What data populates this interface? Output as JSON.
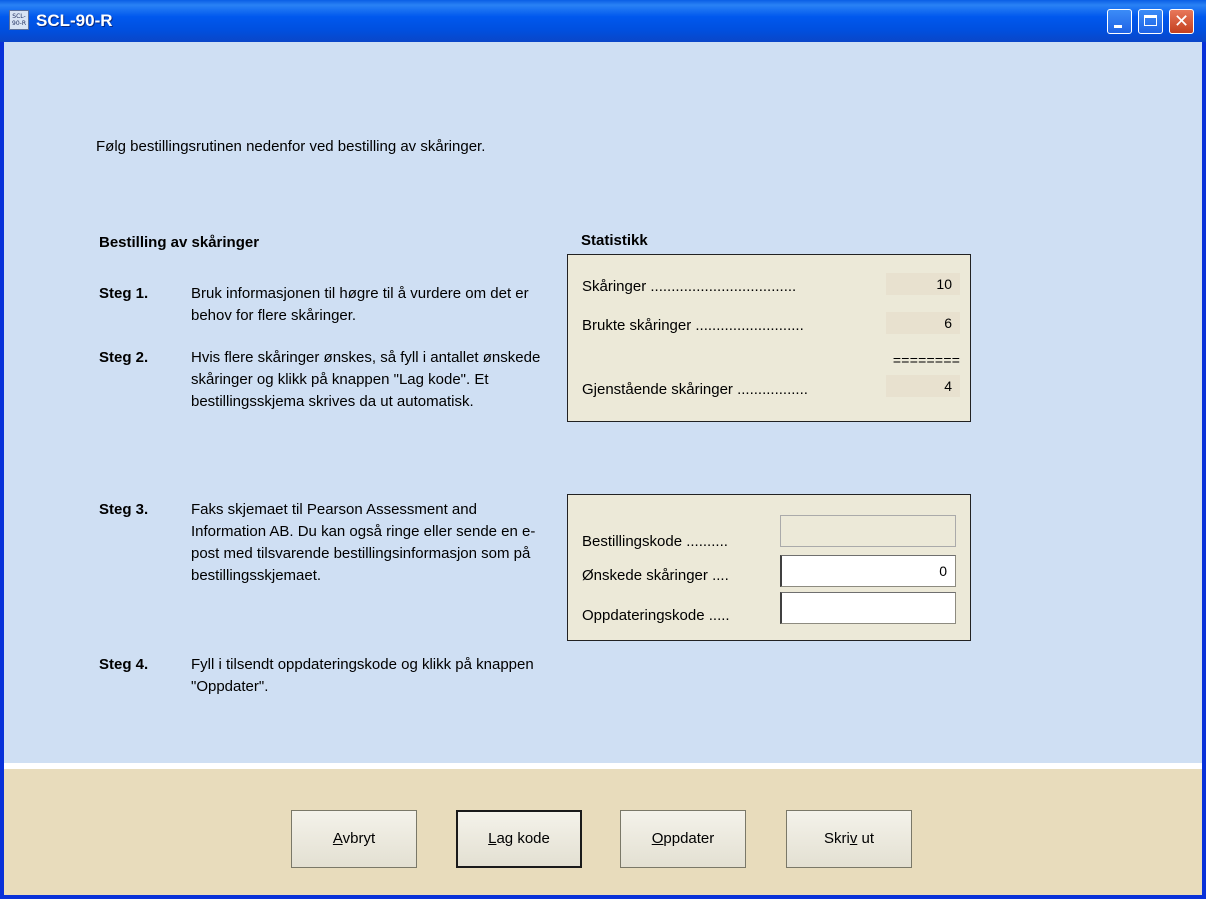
{
  "window": {
    "title": "SCL-90-R",
    "icon_text": "SCL-90-R",
    "controls": {
      "minimize": "minimize-icon",
      "maximize": "maximize-icon",
      "close": "close-icon"
    }
  },
  "intro": "Følg bestillingsrutinen nedenfor ved bestilling av skåringer.",
  "ordering": {
    "heading": "Bestilling av skåringer",
    "steps": [
      {
        "label": "Steg 1.",
        "text": "Bruk informasjonen til høgre til å vurdere om det er behov for flere skåringer."
      },
      {
        "label": "Steg 2.",
        "text": "Hvis flere skåringer ønskes, så fyll i antallet ønskede skåringer og klikk på knappen \"Lag kode\". Et bestillingsskjema skrives da ut automatisk."
      },
      {
        "label": "Steg 3.",
        "text": "Faks skjemaet til Pearson Assessment and Information AB. Du kan også ringe eller sende en e-post med tilsvarende bestillingsinformasjon som på bestillingsskjemaet."
      },
      {
        "label": "Steg 4.",
        "text": "Fyll i tilsendt oppdateringskode og klikk på knappen \"Oppdater\"."
      }
    ]
  },
  "statistics": {
    "heading": "Statistikk",
    "rows": [
      {
        "label": "Skåringer ...................................",
        "value": "10"
      },
      {
        "label": "Brukte skåringer ..........................",
        "value": "6"
      },
      {
        "label": "Gjenstående skåringer .................",
        "value": "4"
      }
    ],
    "separator": "========"
  },
  "order_form": {
    "fields": [
      {
        "label": "Bestillingskode ..........",
        "value": ""
      },
      {
        "label": "Ønskede skåringer ....",
        "value": "0"
      },
      {
        "label": "Oppdateringskode .....",
        "value": ""
      }
    ]
  },
  "buttons": {
    "cancel": {
      "before": "",
      "mnemonic": "A",
      "after": "vbryt"
    },
    "make_code": {
      "before": "",
      "mnemonic": "L",
      "after": "ag kode"
    },
    "update": {
      "before": "",
      "mnemonic": "O",
      "after": "ppdater"
    },
    "print": {
      "before": "Skri",
      "mnemonic": "v",
      "after": " ut"
    }
  }
}
